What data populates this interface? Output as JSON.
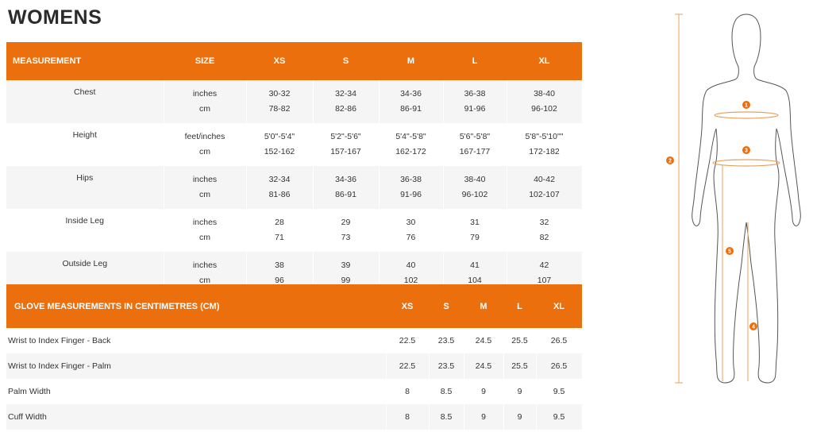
{
  "title": "WOMENS",
  "size_table": {
    "headers": [
      "MEASUREMENT",
      "SIZE",
      "XS",
      "S",
      "M",
      "L",
      "XL"
    ],
    "rows": [
      {
        "name": "Chest",
        "units": [
          "inches",
          "cm"
        ],
        "xs": [
          "30-32",
          "78-82"
        ],
        "s": [
          "32-34",
          "82-86"
        ],
        "m": [
          "34-36",
          "86-91"
        ],
        "l": [
          "36-38",
          "91-96"
        ],
        "xl": [
          "38-40",
          "96-102"
        ]
      },
      {
        "name": "Height",
        "units": [
          "feet/inches",
          "cm"
        ],
        "xs": [
          "5'0\"-5'4\"",
          "152-162"
        ],
        "s": [
          "5'2\"-5'6\"",
          "157-167"
        ],
        "m": [
          "5'4\"-5'8\"",
          "162-172"
        ],
        "l": [
          "5'6\"-5'8\"",
          "167-177"
        ],
        "xl": [
          "5'8\"-5'10\"\"",
          "172-182"
        ]
      },
      {
        "name": "Hips",
        "units": [
          "inches",
          "cm"
        ],
        "xs": [
          "32-34",
          "81-86"
        ],
        "s": [
          "34-36",
          "86-91"
        ],
        "m": [
          "36-38",
          "91-96"
        ],
        "l": [
          "38-40",
          "96-102"
        ],
        "xl": [
          "40-42",
          "102-107"
        ]
      },
      {
        "name": "Inside Leg",
        "units": [
          "inches",
          "cm"
        ],
        "xs": [
          "28",
          "71"
        ],
        "s": [
          "29",
          "73"
        ],
        "m": [
          "30",
          "76"
        ],
        "l": [
          "31",
          "79"
        ],
        "xl": [
          "32",
          "82"
        ]
      },
      {
        "name": "Outside Leg",
        "units": [
          "inches",
          "cm"
        ],
        "xs": [
          "38",
          "96"
        ],
        "s": [
          "39",
          "99"
        ],
        "m": [
          "40",
          "102"
        ],
        "l": [
          "41",
          "104"
        ],
        "xl": [
          "42",
          "107"
        ]
      }
    ]
  },
  "glove_table": {
    "headers": [
      "GLOVE MEASUREMENTS IN CENTIMETRES (CM)",
      "XS",
      "S",
      "M",
      "L",
      "XL"
    ],
    "rows": [
      {
        "name": "Wrist to Index Finger - Back",
        "xs": "22.5",
        "s": "23.5",
        "m": "24.5",
        "l": "25.5",
        "xl": "26.5"
      },
      {
        "name": "Wrist to Index Finger - Palm",
        "xs": "22.5",
        "s": "23.5",
        "m": "24.5",
        "l": "25.5",
        "xl": "26.5"
      },
      {
        "name": "Palm Width",
        "xs": "8",
        "s": "8.5",
        "m": "9",
        "l": "9",
        "xl": "9.5"
      },
      {
        "name": "Cuff Width",
        "xs": "8",
        "s": "8.5",
        "m": "9",
        "l": "9",
        "xl": "9.5"
      }
    ]
  },
  "figure": {
    "markers": [
      "1",
      "2",
      "3",
      "4",
      "5"
    ],
    "accent_color": "#ec6f0e",
    "line_color": "#e8a15a"
  }
}
